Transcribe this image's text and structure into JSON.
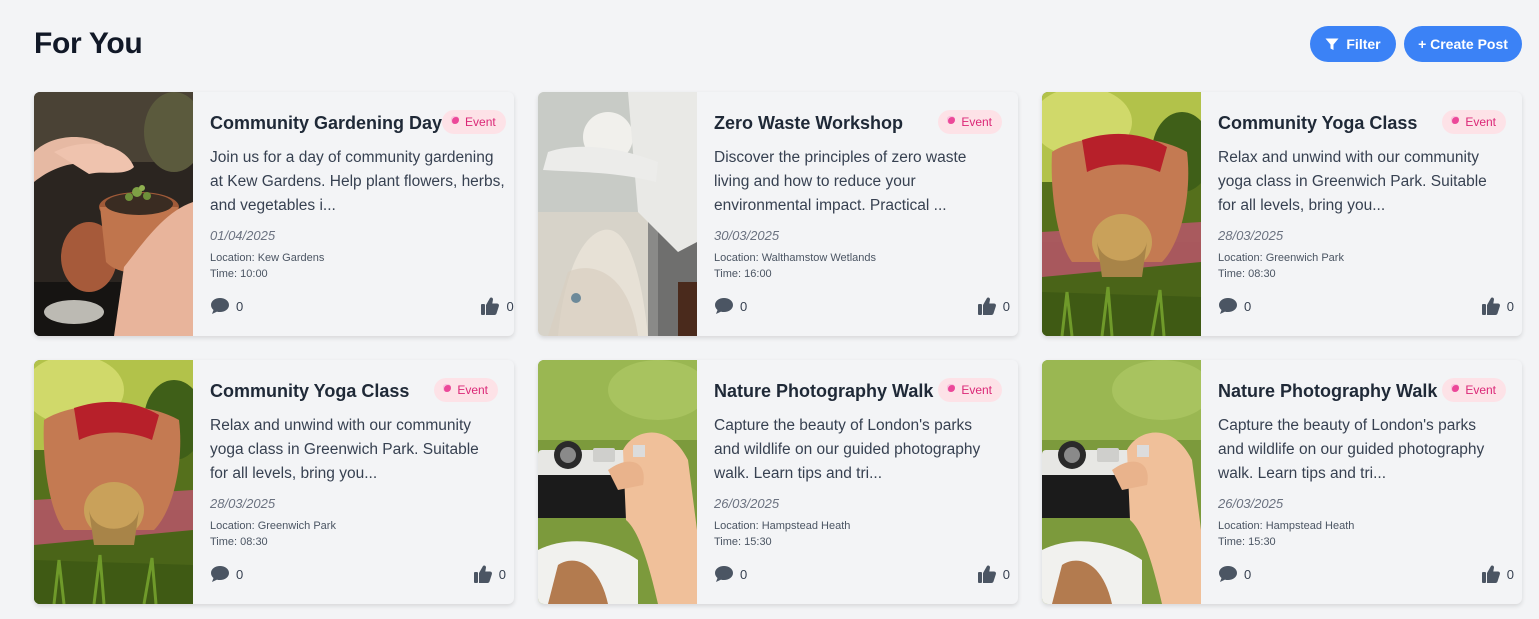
{
  "page": {
    "title": "For You"
  },
  "toolbar": {
    "filter_label": "Filter",
    "create_label": "+ Create Post"
  },
  "colors": {
    "accent": "#3b82f6",
    "badge_bg": "#fde2e7",
    "badge_text": "#db2777",
    "background": "#f3f4f6"
  },
  "cards": [
    {
      "title": "Community Gardening Day",
      "badge": "Event",
      "description": "Join us for a day of community gardening at Kew Gardens. Help plant flowers, herbs, and vegetables i...",
      "date": "01/04/2025",
      "location": "Location: Kew Gardens",
      "time": "Time: 10:00",
      "comments": "0",
      "likes": "0",
      "image": "potted-seedling-photo"
    },
    {
      "title": "Zero Waste Workshop",
      "badge": "Event",
      "description": "Discover the principles of zero waste living and how to reduce your environmental impact. Practical ...",
      "date": "30/03/2025",
      "location": "Location: Walthamstow Wetlands",
      "time": "Time: 16:00",
      "comments": "0",
      "likes": "0",
      "image": "gloved-hands-litter-photo"
    },
    {
      "title": "Community Yoga Class",
      "badge": "Event",
      "description": "Relax and unwind with our community yoga class in Greenwich Park. Suitable for all levels, bring you...",
      "date": "28/03/2025",
      "location": "Location: Greenwich Park",
      "time": "Time: 08:30",
      "comments": "0",
      "likes": "0",
      "image": "yoga-pose-grass-photo"
    },
    {
      "title": "Community Yoga Class",
      "badge": "Event",
      "description": "Relax and unwind with our community yoga class in Greenwich Park. Suitable for all levels, bring you...",
      "date": "28/03/2025",
      "location": "Location: Greenwich Park",
      "time": "Time: 08:30",
      "comments": "0",
      "likes": "0",
      "image": "yoga-pose-grass-photo"
    },
    {
      "title": "Nature Photography Walk",
      "badge": "Event",
      "description": "Capture the beauty of London's parks and wildlife on our guided photography walk. Learn tips and tri...",
      "date": "26/03/2025",
      "location": "Location: Hampstead Heath",
      "time": "Time: 15:30",
      "comments": "0",
      "likes": "0",
      "image": "camera-on-grass-photo"
    },
    {
      "title": "Nature Photography Walk",
      "badge": "Event",
      "description": "Capture the beauty of London's parks and wildlife on our guided photography walk. Learn tips and tri...",
      "date": "26/03/2025",
      "location": "Location: Hampstead Heath",
      "time": "Time: 15:30",
      "comments": "0",
      "likes": "0",
      "image": "camera-on-grass-photo"
    }
  ]
}
